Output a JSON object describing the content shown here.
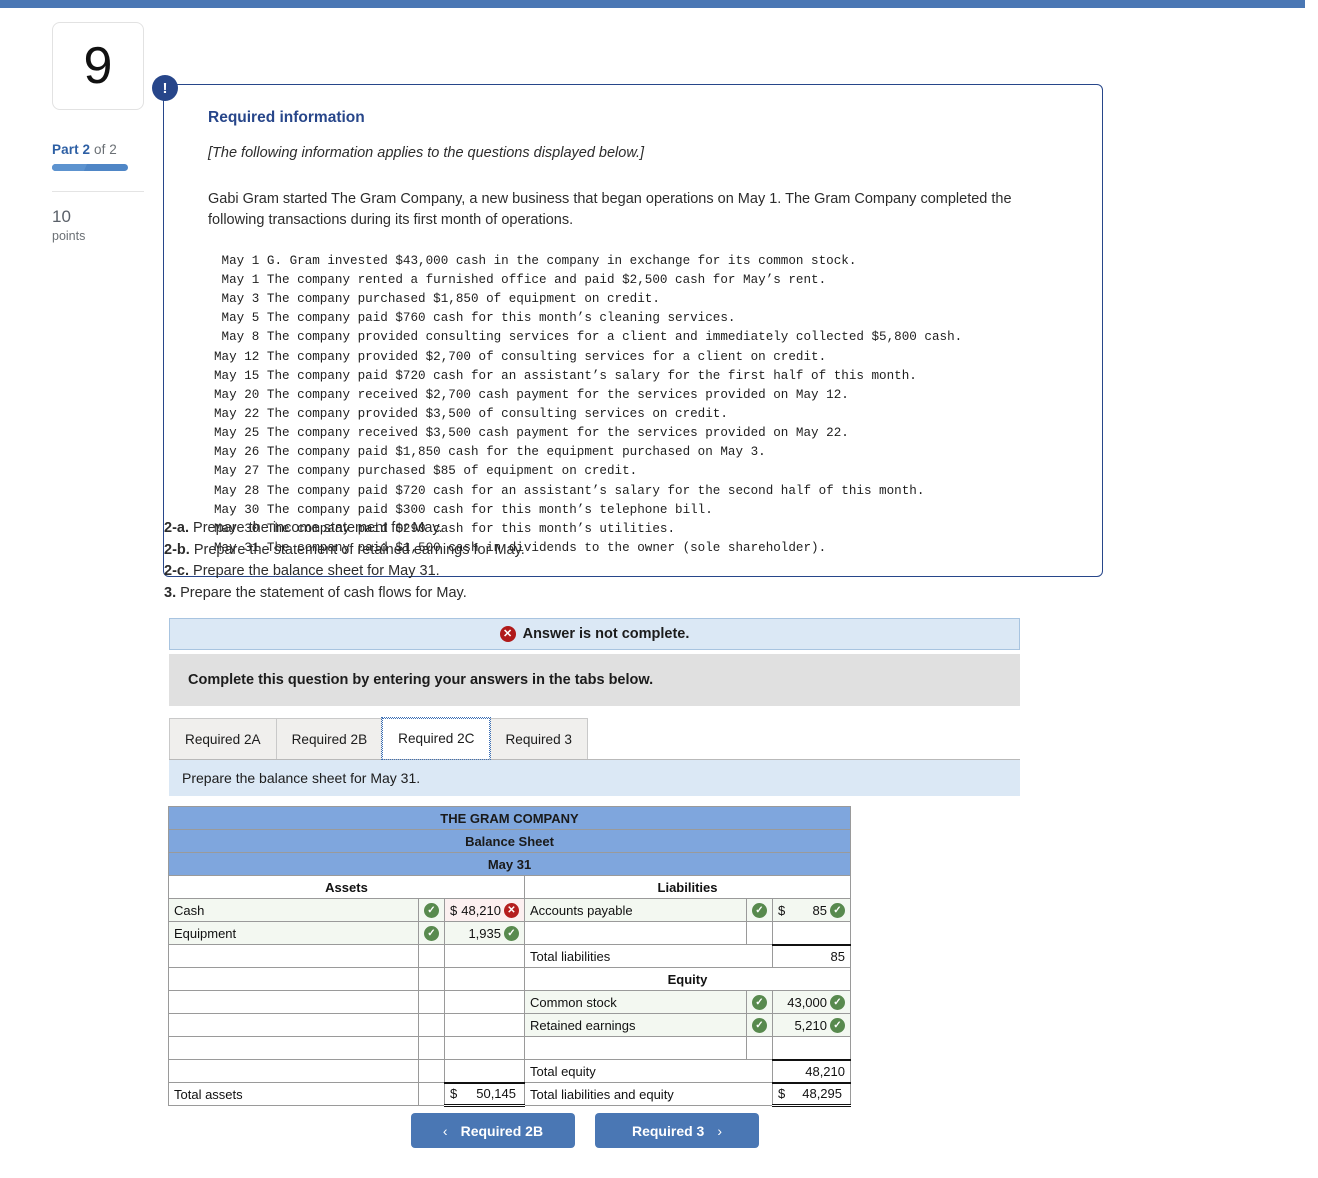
{
  "rail": {
    "question_number": "9",
    "part_prefix": "Part",
    "part_current": "2",
    "part_of": "of 2",
    "points_value": "10",
    "points_label": "points"
  },
  "info_box": {
    "badge": "!",
    "title": "Required information",
    "note": "[The following information applies to the questions displayed below.]",
    "intro": "Gabi Gram started The Gram Company, a new business that began operations on May 1. The Gram Company completed the following transactions during its first month of operations.",
    "transactions": " May 1 G. Gram invested $43,000 cash in the company in exchange for its common stock.\n May 1 The company rented a furnished office and paid $2,500 cash for May’s rent.\n May 3 The company purchased $1,850 of equipment on credit.\n May 5 The company paid $760 cash for this month’s cleaning services.\n May 8 The company provided consulting services for a client and immediately collected $5,800 cash.\nMay 12 The company provided $2,700 of consulting services for a client on credit.\nMay 15 The company paid $720 cash for an assistant’s salary for the first half of this month.\nMay 20 The company received $2,700 cash payment for the services provided on May 12.\nMay 22 The company provided $3,500 of consulting services on credit.\nMay 25 The company received $3,500 cash payment for the services provided on May 22.\nMay 26 The company paid $1,850 cash for the equipment purchased on May 3.\nMay 27 The company purchased $85 of equipment on credit.\nMay 28 The company paid $720 cash for an assistant’s salary for the second half of this month.\nMay 30 The company paid $300 cash for this month’s telephone bill.\nMay 30 The company paid $290 cash for this month’s utilities.\nMay 31 The company paid $1,500 cash in dividends to the owner (sole shareholder)."
  },
  "requirements": [
    {
      "num": "2-a.",
      "text": "Prepare the income statement for May."
    },
    {
      "num": "2-b.",
      "text": "Prepare the statement of retained earnings for May."
    },
    {
      "num": "2-c.",
      "text": "Prepare the balance sheet for May 31."
    },
    {
      "num": "3.",
      "text": "Prepare the statement of cash flows for May."
    }
  ],
  "banners": {
    "incomplete": "Answer is not complete.",
    "incomplete_icon": "x-circle-icon",
    "instruction": "Complete this question by entering your answers in the tabs below."
  },
  "tabs": {
    "items": [
      {
        "label": "Required 2A",
        "active": false
      },
      {
        "label": "Required 2B",
        "active": false
      },
      {
        "label": "Required 2C",
        "active": true
      },
      {
        "label": "Required 3",
        "active": false
      }
    ],
    "description": "Prepare the balance sheet for May 31."
  },
  "balance_sheet": {
    "company": "THE GRAM COMPANY",
    "statement": "Balance Sheet",
    "date": "May 31",
    "assets_header": "Assets",
    "liabilities_header": "Liabilities",
    "equity_header": "Equity",
    "rows": [
      {
        "left_label": "Cash",
        "left_mark": "check",
        "left_dollar": "$",
        "left_amount": "48,210",
        "left_amount_mark": "x",
        "left_tint": "bad",
        "right_label": "Accounts payable",
        "right_mark": "check",
        "right_dollar": "$",
        "right_amount": "85",
        "right_amount_mark": "check",
        "right_tint": "good"
      },
      {
        "left_label": "Equipment",
        "left_mark": "check",
        "left_dollar": "",
        "left_amount": "1,935",
        "left_amount_mark": "check",
        "left_tint": "good",
        "right_label": "",
        "right_mark": "",
        "right_dollar": "",
        "right_amount": "",
        "right_amount_mark": "",
        "right_tint": ""
      }
    ],
    "total_liabilities_label": "Total liabilities",
    "total_liabilities_amount": "85",
    "equity_rows": [
      {
        "label": "Common stock",
        "mark": "check",
        "amount": "43,000",
        "amount_mark": "check"
      },
      {
        "label": "Retained earnings",
        "mark": "check",
        "amount": "5,210",
        "amount_mark": "check"
      }
    ],
    "total_equity_label": "Total equity",
    "total_equity_amount": "48,210",
    "total_assets_label": "Total assets",
    "total_assets_dollar": "$",
    "total_assets_amount": "50,145",
    "total_le_label": "Total liabilities and equity",
    "total_le_dollar": "$",
    "total_le_amount": "48,295"
  },
  "nav": {
    "prev_label": "Required 2B",
    "prev_icon": "chevron-left-icon",
    "next_label": "Required 3",
    "next_icon": "chevron-right-icon"
  },
  "colors": {
    "topbar": "#4a77b4",
    "accent_blue": "#27468a",
    "table_header_blue": "#7fa6dd",
    "correct_green": "#588a4e",
    "incorrect_red": "#b51f1f",
    "banner_blue": "#dbe8f5",
    "banner_gray": "#e0e0e0"
  }
}
